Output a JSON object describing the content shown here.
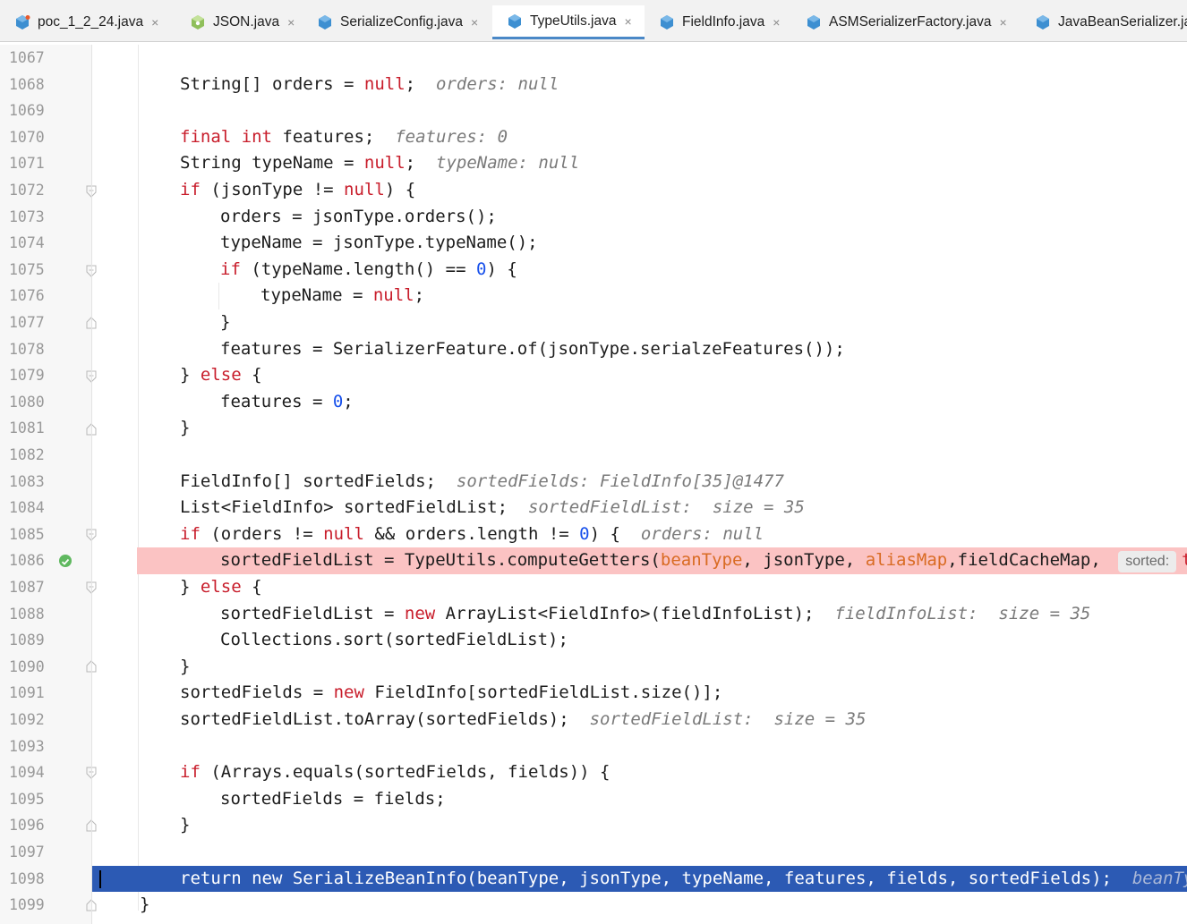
{
  "tabs": [
    {
      "label": "poc_1_2_24.java",
      "icon": "java-class-icon",
      "active": false
    },
    {
      "label": "JSON.java",
      "icon": "java-interface-icon",
      "active": false
    },
    {
      "label": "SerializeConfig.java",
      "icon": "java-class-icon",
      "active": false
    },
    {
      "label": "TypeUtils.java",
      "icon": "java-class-icon",
      "active": true
    },
    {
      "label": "FieldInfo.java",
      "icon": "java-class-icon",
      "active": false
    },
    {
      "label": "ASMSerializerFactory.java",
      "icon": "java-class-icon",
      "active": false
    },
    {
      "label": "JavaBeanSerializer.ja",
      "icon": "java-class-icon",
      "active": false
    }
  ],
  "close_glyph": "×",
  "line_numbers": [
    "1067",
    "1068",
    "1069",
    "1070",
    "1071",
    "1072",
    "1073",
    "1074",
    "1075",
    "1076",
    "1077",
    "1078",
    "1079",
    "1080",
    "1081",
    "1082",
    "1083",
    "1084",
    "1085",
    "1086",
    "1087",
    "1088",
    "1089",
    "1090",
    "1091",
    "1092",
    "1093",
    "1094",
    "1095",
    "1096",
    "1097",
    "1098",
    "1099"
  ],
  "code": {
    "l1068": {
      "t1": "String[] orders = ",
      "k1": "null",
      "t2": ";",
      "hint": "orders: null"
    },
    "l1070": {
      "k1": "final int",
      "t1": " features;",
      "hint": "features: 0"
    },
    "l1071": {
      "t1": "String typeName = ",
      "k1": "null",
      "t2": ";",
      "hint": "typeName: null"
    },
    "l1072": {
      "k1": "if",
      "t1": " (jsonType != ",
      "k2": "null",
      "t2": ") {"
    },
    "l1073": {
      "t1": "orders = jsonType.orders();"
    },
    "l1074": {
      "t1": "typeName = jsonType.typeName();"
    },
    "l1075": {
      "k1": "if",
      "t1": " (typeName.length() == ",
      "n1": "0",
      "t2": ") {"
    },
    "l1076": {
      "t1": "typeName = ",
      "k1": "null",
      "t2": ";"
    },
    "l1077": {
      "t1": "}"
    },
    "l1078": {
      "t1": "features = SerializerFeature.of(jsonType.serialzeFeatures());"
    },
    "l1079": {
      "t1": "} ",
      "k1": "else",
      "t2": " {"
    },
    "l1080": {
      "t1": "features = ",
      "n1": "0",
      "t2": ";"
    },
    "l1081": {
      "t1": "}"
    },
    "l1083": {
      "t1": "FieldInfo[] sortedFields;",
      "hint": "sortedFields: FieldInfo[35]@1477"
    },
    "l1084": {
      "t1": "List<FieldInfo> sortedFieldList;",
      "hint": "sortedFieldList:  size = 35"
    },
    "l1085": {
      "k1": "if",
      "t1": " (orders != ",
      "k2": "null",
      "t2": " && orders.length != ",
      "n1": "0",
      "t3": ") {",
      "hint": "orders: null"
    },
    "l1086": {
      "t1": "sortedFieldList = TypeUtils.computeGetters(",
      "f1": "beanType",
      "t2": ", jsonType, ",
      "f2": "aliasMap",
      "t3": ",fieldCacheMap, ",
      "chip": "sorted:",
      "tail": "tr"
    },
    "l1087": {
      "t1": "} ",
      "k1": "else",
      "t2": " {"
    },
    "l1088": {
      "t1": "sortedFieldList = ",
      "k1": "new",
      "t2": " ArrayList<FieldInfo>(fieldInfoList);",
      "hint": "fieldInfoList:  size = 35"
    },
    "l1089": {
      "t1": "Collections.sort(sortedFieldList);"
    },
    "l1090": {
      "t1": "}"
    },
    "l1091": {
      "t1": "sortedFields = ",
      "k1": "new",
      "t2": " FieldInfo[sortedFieldList.size()];"
    },
    "l1092": {
      "t1": "sortedFieldList.toArray(sortedFields);",
      "hint": "sortedFieldList:  size = 35"
    },
    "l1094": {
      "k1": "if",
      "t1": " (Arrays.equals(sortedFields, fields)) {"
    },
    "l1095": {
      "t1": "sortedFields = fields;"
    },
    "l1096": {
      "t1": "}"
    },
    "l1098": {
      "t1": "return new SerializeBeanInfo(beanType, jsonType, typeName, features, fields, sortedFields);",
      "hint": "beanTyp"
    },
    "l1099": {
      "t1": "}"
    }
  },
  "colors": {
    "breakpoint_line": "#fbc3c3",
    "execution_line": "#2c5ab4",
    "keyword": "#c81d2b",
    "number": "#1750eb",
    "field": "#d96b23",
    "active_tab_underline": "#4a88c7"
  }
}
